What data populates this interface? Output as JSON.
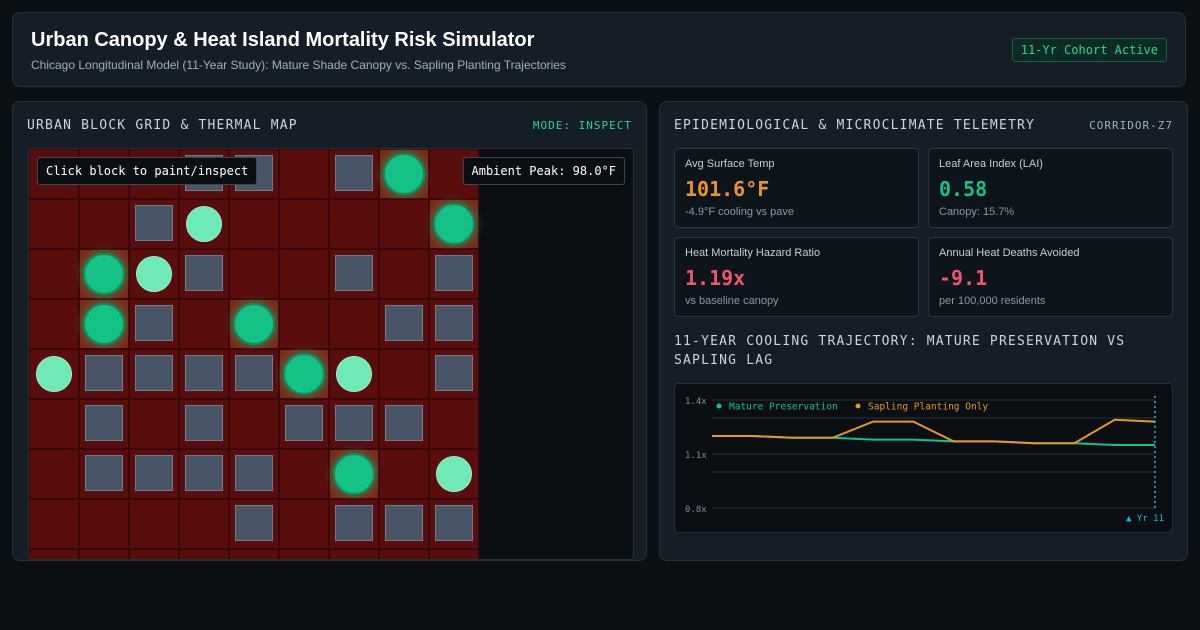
{
  "header": {
    "title": "Urban Canopy & Heat Island Mortality Risk Simulator",
    "subtitle": "Chicago Longitudinal Model (11-Year Study): Mature Shade Canopy vs. Sapling Planting Trajectories",
    "badge": "11-Yr Cohort Active"
  },
  "colors": {
    "accent_green": "#14c286",
    "sapling_green": "#6ee9b8",
    "warning_orange": "#e8962a",
    "danger_red": "#f0566b",
    "info_cyan": "#1fb8e0"
  },
  "map_panel": {
    "title": "URBAN BLOCK GRID & THERMAL MAP",
    "mode": "MODE: INSPECT",
    "tip_left": "Click block to paint/inspect",
    "tip_right": "Ambient Peak: 98.0°F",
    "legend": {
      "building": "building-block",
      "mature": "mature-tree",
      "sapling": "sapling-tree",
      "pavement": "pavement"
    },
    "rows": [
      [
        "P",
        "P",
        "P",
        "B",
        "B",
        "P",
        "B",
        "M",
        "P"
      ],
      [
        "P",
        "P",
        "B",
        "S",
        "P",
        "P",
        "P",
        "P",
        "M"
      ],
      [
        "P",
        "M",
        "S",
        "B",
        "P",
        "P",
        "B",
        "P",
        "B"
      ],
      [
        "P",
        "M",
        "B",
        "P",
        "M",
        "P",
        "P",
        "B",
        "B"
      ],
      [
        "S",
        "B",
        "B",
        "B",
        "B",
        "M",
        "S",
        "P",
        "B"
      ],
      [
        "P",
        "B",
        "P",
        "B",
        "P",
        "B",
        "B",
        "B",
        "P"
      ],
      [
        "P",
        "B",
        "B",
        "B",
        "B",
        "P",
        "M",
        "P",
        "S"
      ],
      [
        "P",
        "P",
        "P",
        "P",
        "B",
        "P",
        "B",
        "B",
        "B"
      ],
      [
        "P",
        "P",
        "P",
        "P",
        "P",
        "P",
        "P",
        "P",
        "P"
      ]
    ]
  },
  "telemetry": {
    "title": "EPIDEMIOLOGICAL & MICROCLIMATE TELEMETRY",
    "corridor": "CORRIDOR-Z7",
    "stats": [
      {
        "label": "Avg Surface Temp",
        "value": "101.6°F",
        "note": "-4.9°F cooling vs pave",
        "color": "#e8962a"
      },
      {
        "label": "Leaf Area Index (LAI)",
        "value": "0.58",
        "note": "Canopy: 15.7%",
        "color": "#14c286"
      },
      {
        "label": "Heat Mortality Hazard Ratio",
        "value": "1.19x",
        "note": "vs baseline canopy",
        "color": "#f0566b"
      },
      {
        "label": "Annual Heat Deaths Avoided",
        "value": "-9.1",
        "note": "per 100,000 residents",
        "color": "#f0566b"
      }
    ]
  },
  "trajectory": {
    "title": "11-YEAR COOLING TRAJECTORY: MATURE PRESERVATION VS SAPLING LAG"
  },
  "chart_data": {
    "type": "line",
    "x": [
      0,
      1,
      2,
      3,
      4,
      5,
      6,
      7,
      8,
      9,
      10,
      11
    ],
    "series": [
      {
        "name": "Mature Preservation",
        "color": "#14c286",
        "values": [
          1.2,
          1.2,
          1.19,
          1.19,
          1.18,
          1.18,
          1.17,
          1.17,
          1.16,
          1.16,
          1.15,
          1.15
        ]
      },
      {
        "name": "Sapling Planting Only",
        "color": "#e8962a",
        "values": [
          1.2,
          1.2,
          1.19,
          1.19,
          1.28,
          1.28,
          1.17,
          1.17,
          1.16,
          1.16,
          1.29,
          1.28
        ]
      }
    ],
    "yticks": [
      "1.4x",
      "1.1x",
      "0.8x"
    ],
    "ylim": [
      0.8,
      1.4
    ],
    "marker_label": "▲ Yr 11",
    "marker_x": 11,
    "grid": true,
    "legend_position": "top-left"
  }
}
